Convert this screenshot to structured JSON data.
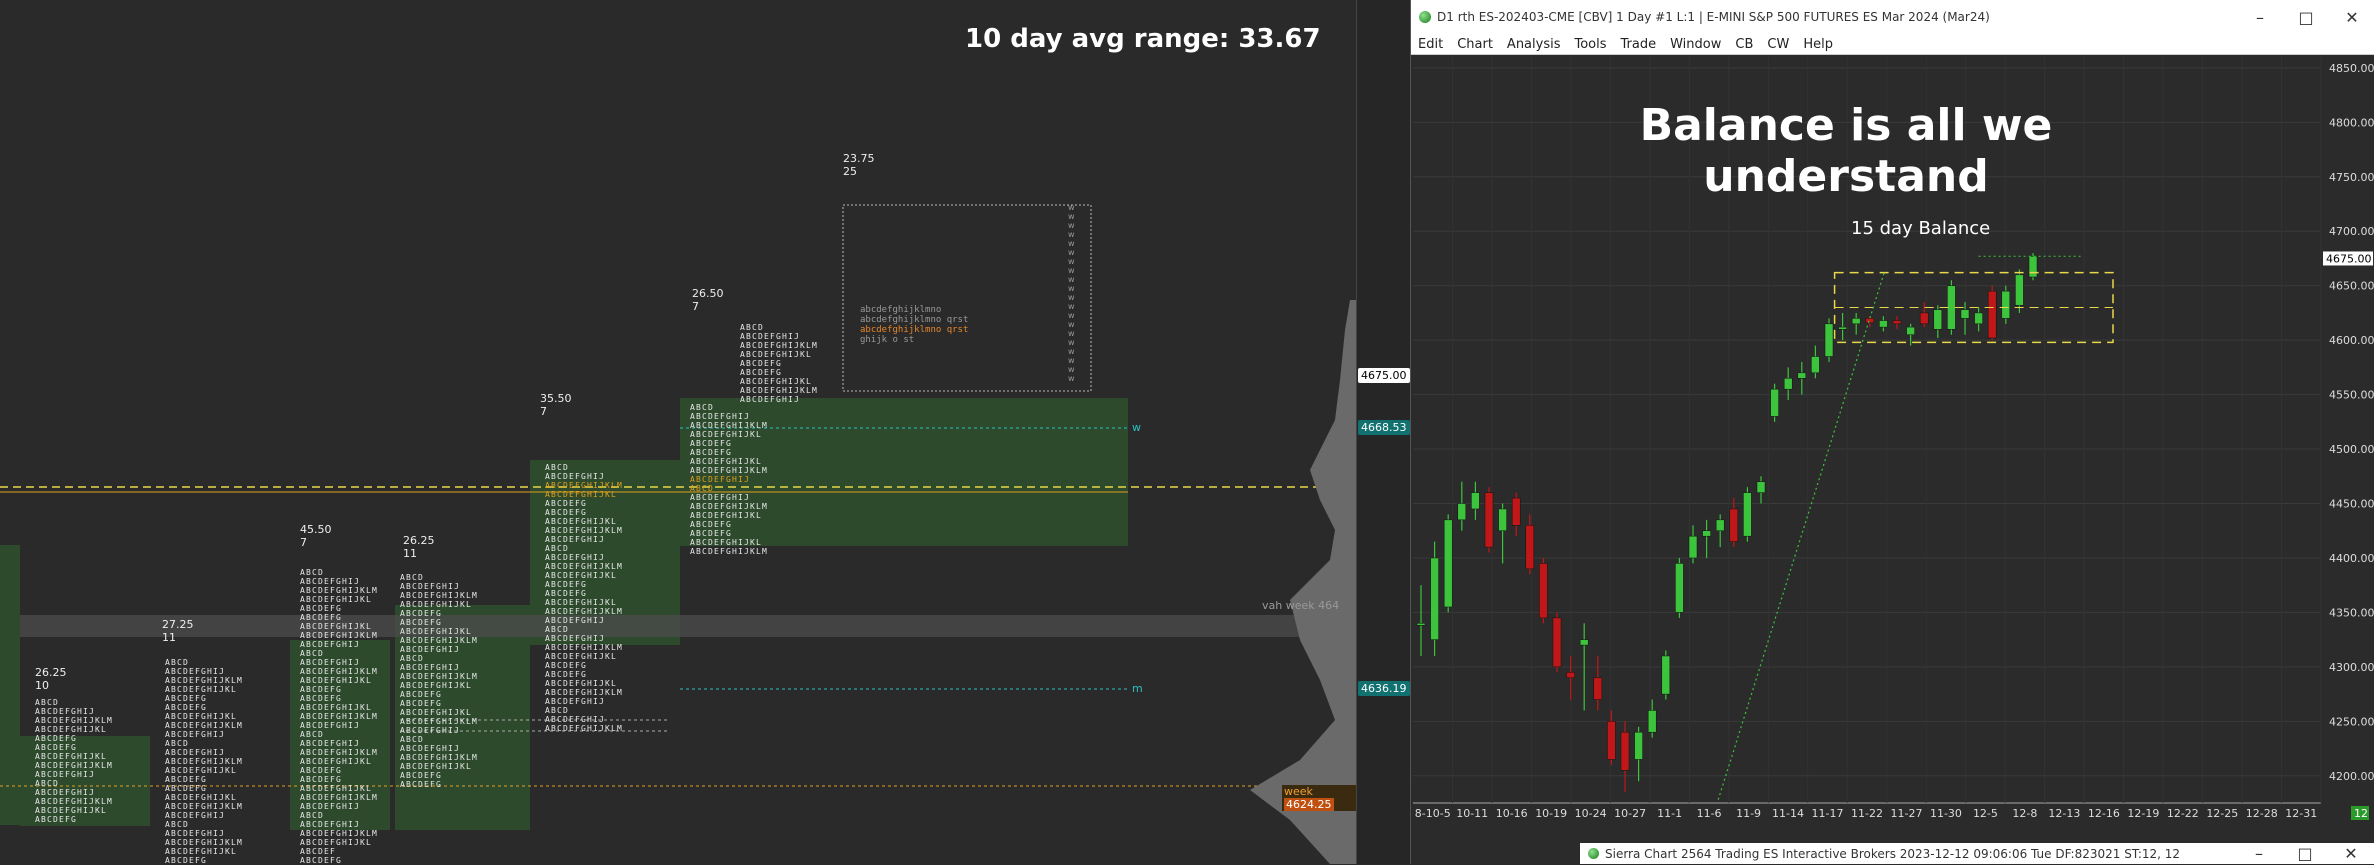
{
  "left_panel": {
    "avg_range_text": "10 day avg range:  33.67",
    "profiles": [
      {
        "range": "26.25",
        "count": "10"
      },
      {
        "range": "27.25",
        "count": "11"
      },
      {
        "range": "45.50",
        "count": "7"
      },
      {
        "range": "26.25",
        "count": "11"
      },
      {
        "range": "35.50",
        "count": "7"
      },
      {
        "range": "26.50",
        "count": "7"
      },
      {
        "range": "23.75",
        "count": "25"
      }
    ],
    "level_labels": {
      "vah_week": "vah week",
      "vah_week_value": "464",
      "week": "week",
      "week_value": "4624.25",
      "w_marker": "w",
      "m_marker": "m"
    },
    "price_badges": {
      "p1": "4675.00",
      "p2": "4668.53",
      "p3": "4636.19"
    }
  },
  "chart_window": {
    "title": "D1 rth ES-202403-CME [CBV]  1 Day  #1 L:1 | E-MINI S&P 500 FUTURES ES Mar 2024 (Mar24)",
    "menu": [
      "Edit",
      "Chart",
      "Analysis",
      "Tools",
      "Trade",
      "Window",
      "CB",
      "CW",
      "Help"
    ],
    "heading": "Balance is all we understand",
    "balance_label": "15 day Balance",
    "y_ticks": [
      "4850.00",
      "4800.00",
      "4750.00",
      "4700.00",
      "4650.00",
      "4600.00",
      "4550.00",
      "4500.00",
      "4450.00",
      "4400.00",
      "4350.00",
      "4300.00",
      "4250.00",
      "4200.00"
    ],
    "current_price": "4675.00",
    "x_ticks": [
      "8-10-5",
      "10-11",
      "10-16",
      "10-19",
      "10-24",
      "10-27",
      "11-1",
      "11-6",
      "11-9",
      "11-14",
      "11-17",
      "11-22",
      "11-27",
      "11-30",
      "12-5",
      "12-8",
      "12-13",
      "12-16",
      "12-19",
      "12-22",
      "12-25",
      "12-28",
      "12-31"
    ],
    "corner_value": "12"
  },
  "chart_data": {
    "type": "candlestick",
    "ylim": [
      4175,
      4860
    ],
    "candles": [
      {
        "o": 4340,
        "h": 4375,
        "l": 4310,
        "c": 4340
      },
      {
        "o": 4325,
        "h": 4415,
        "l": 4310,
        "c": 4400
      },
      {
        "o": 4355,
        "h": 4440,
        "l": 4350,
        "c": 4435
      },
      {
        "o": 4435,
        "h": 4470,
        "l": 4425,
        "c": 4450
      },
      {
        "o": 4445,
        "h": 4470,
        "l": 4435,
        "c": 4460
      },
      {
        "o": 4460,
        "h": 4465,
        "l": 4405,
        "c": 4410
      },
      {
        "o": 4425,
        "h": 4450,
        "l": 4395,
        "c": 4445
      },
      {
        "o": 4455,
        "h": 4460,
        "l": 4420,
        "c": 4430
      },
      {
        "o": 4430,
        "h": 4440,
        "l": 4385,
        "c": 4390
      },
      {
        "o": 4395,
        "h": 4400,
        "l": 4340,
        "c": 4345
      },
      {
        "o": 4345,
        "h": 4350,
        "l": 4295,
        "c": 4300
      },
      {
        "o": 4295,
        "h": 4310,
        "l": 4270,
        "c": 4290
      },
      {
        "o": 4320,
        "h": 4340,
        "l": 4260,
        "c": 4325
      },
      {
        "o": 4290,
        "h": 4310,
        "l": 4260,
        "c": 4270
      },
      {
        "o": 4250,
        "h": 4260,
        "l": 4210,
        "c": 4215
      },
      {
        "o": 4240,
        "h": 4250,
        "l": 4185,
        "c": 4205
      },
      {
        "o": 4215,
        "h": 4245,
        "l": 4195,
        "c": 4240
      },
      {
        "o": 4240,
        "h": 4270,
        "l": 4235,
        "c": 4260
      },
      {
        "o": 4275,
        "h": 4315,
        "l": 4270,
        "c": 4310
      },
      {
        "o": 4350,
        "h": 4400,
        "l": 4345,
        "c": 4395
      },
      {
        "o": 4400,
        "h": 4430,
        "l": 4395,
        "c": 4420
      },
      {
        "o": 4420,
        "h": 4435,
        "l": 4400,
        "c": 4425
      },
      {
        "o": 4425,
        "h": 4440,
        "l": 4410,
        "c": 4435
      },
      {
        "o": 4445,
        "h": 4455,
        "l": 4410,
        "c": 4415
      },
      {
        "o": 4420,
        "h": 4465,
        "l": 4415,
        "c": 4460
      },
      {
        "o": 4460,
        "h": 4475,
        "l": 4450,
        "c": 4470
      },
      {
        "o": 4530,
        "h": 4560,
        "l": 4525,
        "c": 4555
      },
      {
        "o": 4555,
        "h": 4575,
        "l": 4545,
        "c": 4565
      },
      {
        "o": 4565,
        "h": 4580,
        "l": 4550,
        "c": 4570
      },
      {
        "o": 4570,
        "h": 4595,
        "l": 4565,
        "c": 4585
      },
      {
        "o": 4585,
        "h": 4620,
        "l": 4580,
        "c": 4615
      },
      {
        "o": 4610,
        "h": 4625,
        "l": 4600,
        "c": 4612
      },
      {
        "o": 4615,
        "h": 4625,
        "l": 4605,
        "c": 4620
      },
      {
        "o": 4620,
        "h": 4622,
        "l": 4612,
        "c": 4616
      },
      {
        "o": 4612,
        "h": 4622,
        "l": 4608,
        "c": 4618
      },
      {
        "o": 4618,
        "h": 4622,
        "l": 4610,
        "c": 4615
      },
      {
        "o": 4605,
        "h": 4615,
        "l": 4595,
        "c": 4612
      },
      {
        "o": 4625,
        "h": 4635,
        "l": 4612,
        "c": 4615
      },
      {
        "o": 4610,
        "h": 4632,
        "l": 4602,
        "c": 4628
      },
      {
        "o": 4610,
        "h": 4655,
        "l": 4605,
        "c": 4650
      },
      {
        "o": 4620,
        "h": 4635,
        "l": 4605,
        "c": 4628
      },
      {
        "o": 4615,
        "h": 4630,
        "l": 4608,
        "c": 4625
      },
      {
        "o": 4645,
        "h": 4650,
        "l": 4600,
        "c": 4602
      },
      {
        "o": 4620,
        "h": 4650,
        "l": 4615,
        "c": 4645
      },
      {
        "o": 4632,
        "h": 4665,
        "l": 4625,
        "c": 4660
      },
      {
        "o": 4658,
        "h": 4680,
        "l": 4655,
        "c": 4677
      }
    ]
  },
  "footer": {
    "text": "Sierra Chart 2564 Trading ES Interactive Brokers 2023-12-12  09:06:06 Tue  DF:823021  ST:12, 12"
  },
  "colors": {
    "bull": "#3cc43c",
    "bear": "#c01818",
    "balance_box": "#e8d84a",
    "value_area": "#2d4a2d",
    "poc": "#e0a020"
  }
}
